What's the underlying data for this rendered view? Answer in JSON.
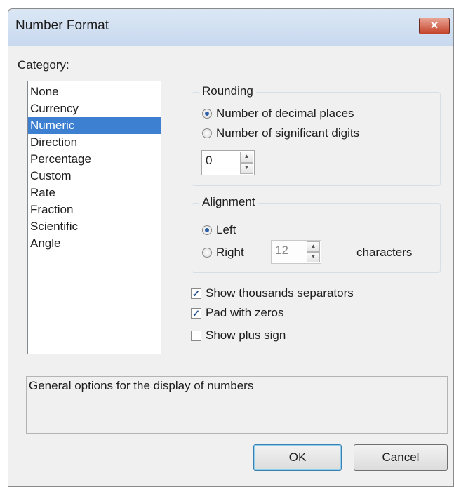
{
  "window": {
    "title": "Number Format",
    "close_glyph": "✕"
  },
  "category": {
    "label": "Category:",
    "items": [
      "None",
      "Currency",
      "Numeric",
      "Direction",
      "Percentage",
      "Custom",
      "Rate",
      "Fraction",
      "Scientific",
      "Angle"
    ],
    "selected": "Numeric"
  },
  "rounding": {
    "title": "Rounding",
    "option_decimal": "Number of decimal places",
    "option_significant": "Number of significant digits",
    "selected": "decimal",
    "value": "0"
  },
  "alignment": {
    "title": "Alignment",
    "option_left": "Left",
    "option_right": "Right",
    "selected": "left",
    "width_value": "12",
    "characters_label": "characters"
  },
  "options": {
    "thousands_label": "Show thousands separators",
    "thousands_checked": true,
    "pad_label": "Pad with zeros",
    "pad_checked": true,
    "plus_label": "Show plus sign",
    "plus_checked": false
  },
  "description": "General options for the display of numbers",
  "buttons": {
    "ok": "OK",
    "cancel": "Cancel"
  },
  "colors": {
    "selection": "#3d80d2",
    "close_button": "#c5442b"
  }
}
